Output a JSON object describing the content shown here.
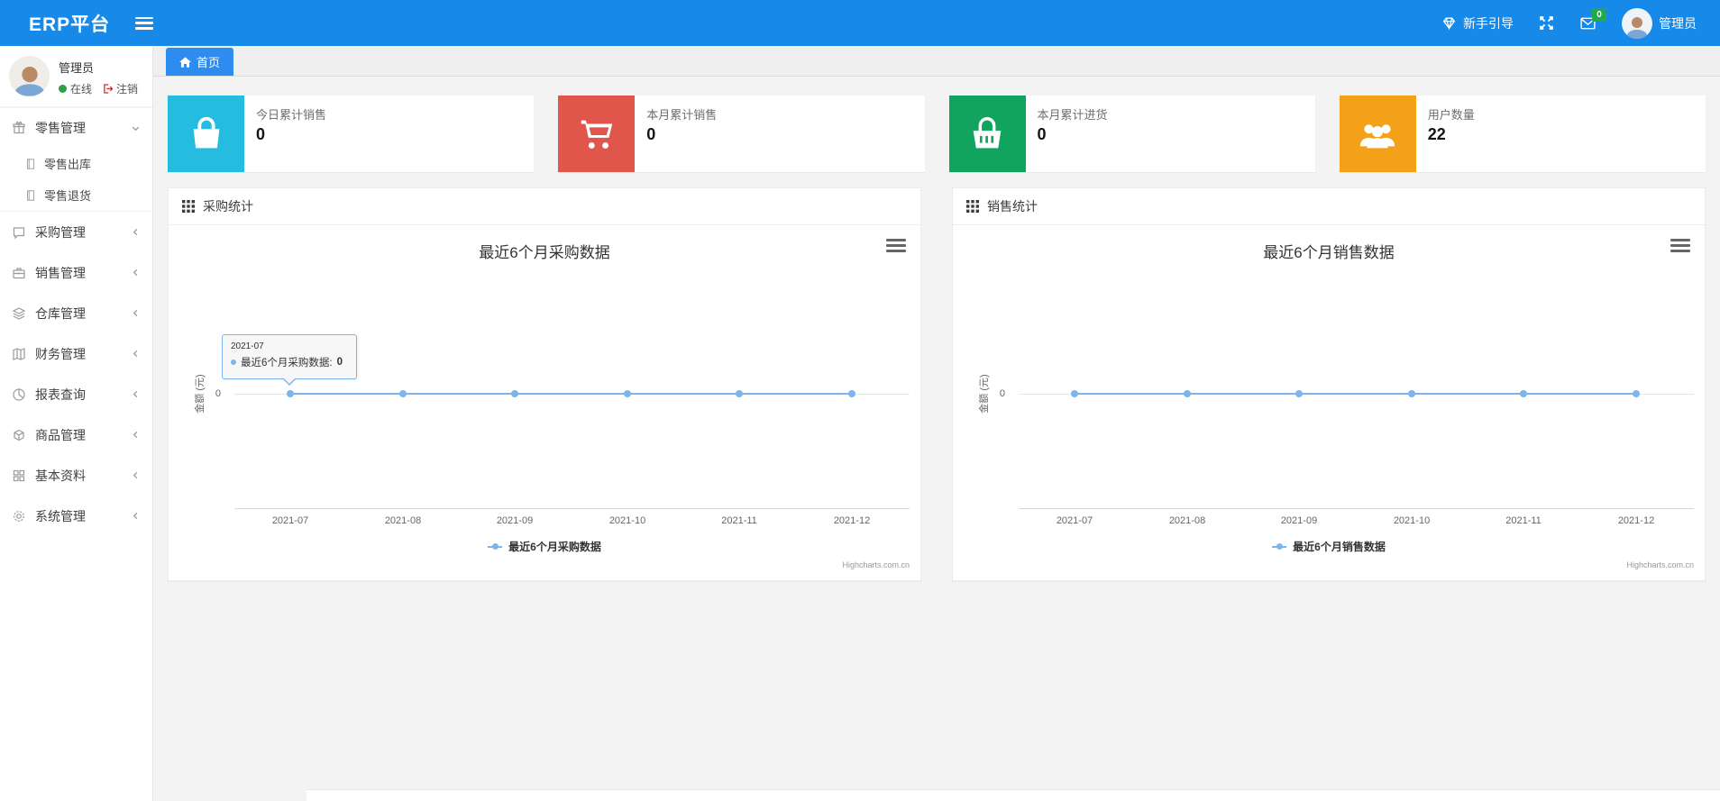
{
  "theme": {
    "navbar_color": "#1789e8",
    "tab_active_color": "#2d8cf0",
    "badge_color": "#1faa4d",
    "series_color": "#7cb5ec"
  },
  "navbar": {
    "brand": "ERP平台",
    "guide_label": "新手引导",
    "mail_badge": "0",
    "user_name": "管理员"
  },
  "sidebar": {
    "user": {
      "name": "管理员",
      "status_label": "在线",
      "logout_label": "注销"
    },
    "items": [
      {
        "icon": "gift-icon",
        "label": "零售管理",
        "expanded": true,
        "children": [
          {
            "icon": "document-icon",
            "label": "零售出库"
          },
          {
            "icon": "document-icon",
            "label": "零售退货"
          }
        ]
      },
      {
        "icon": "chat-square-icon",
        "label": "采购管理"
      },
      {
        "icon": "briefcase-icon",
        "label": "销售管理"
      },
      {
        "icon": "layers-icon",
        "label": "仓库管理"
      },
      {
        "icon": "map-book-icon",
        "label": "财务管理"
      },
      {
        "icon": "pie-chart-icon",
        "label": "报表查询"
      },
      {
        "icon": "box-icon",
        "label": "商品管理"
      },
      {
        "icon": "grid-icon",
        "label": "基本资料"
      },
      {
        "icon": "gear-icon",
        "label": "系统管理"
      }
    ]
  },
  "tabs": {
    "home": {
      "icon": "home-icon",
      "label": "首页"
    }
  },
  "stat_cards": [
    {
      "icon": "shopping-bag-icon",
      "label": "今日累计销售",
      "value": "0",
      "color": "#25bce0"
    },
    {
      "icon": "cart-icon",
      "label": "本月累计销售",
      "value": "0",
      "color": "#e0564b"
    },
    {
      "icon": "basket-icon",
      "label": "本月累计进货",
      "value": "0",
      "color": "#10a45f"
    },
    {
      "icon": "users-icon",
      "label": "用户数量",
      "value": "22",
      "color": "#f3a118"
    }
  ],
  "panels": [
    {
      "header": "采购统计"
    },
    {
      "header": "销售统计"
    }
  ],
  "chart_data": [
    {
      "type": "line",
      "title": "最近6个月采购数据",
      "x": [
        "2021-07",
        "2021-08",
        "2021-09",
        "2021-10",
        "2021-11",
        "2021-12"
      ],
      "series": [
        {
          "name": "最近6个月采购数据",
          "values": [
            0,
            0,
            0,
            0,
            0,
            0
          ],
          "color": "#7cb5ec"
        }
      ],
      "ylabel": "金额 (元)",
      "yticks": [
        "0"
      ],
      "legend_position": "bottom",
      "grid": true,
      "credit": "Highcharts.com.cn",
      "tooltip": {
        "header": "2021-07",
        "label": "最近6个月采购数据:",
        "value": "0"
      }
    },
    {
      "type": "line",
      "title": "最近6个月销售数据",
      "x": [
        "2021-07",
        "2021-08",
        "2021-09",
        "2021-10",
        "2021-11",
        "2021-12"
      ],
      "series": [
        {
          "name": "最近6个月销售数据",
          "values": [
            0,
            0,
            0,
            0,
            0,
            0
          ],
          "color": "#7cb5ec"
        }
      ],
      "ylabel": "金额 (元)",
      "yticks": [
        "0"
      ],
      "legend_position": "bottom",
      "grid": true,
      "credit": "Highcharts.com.cn"
    }
  ]
}
